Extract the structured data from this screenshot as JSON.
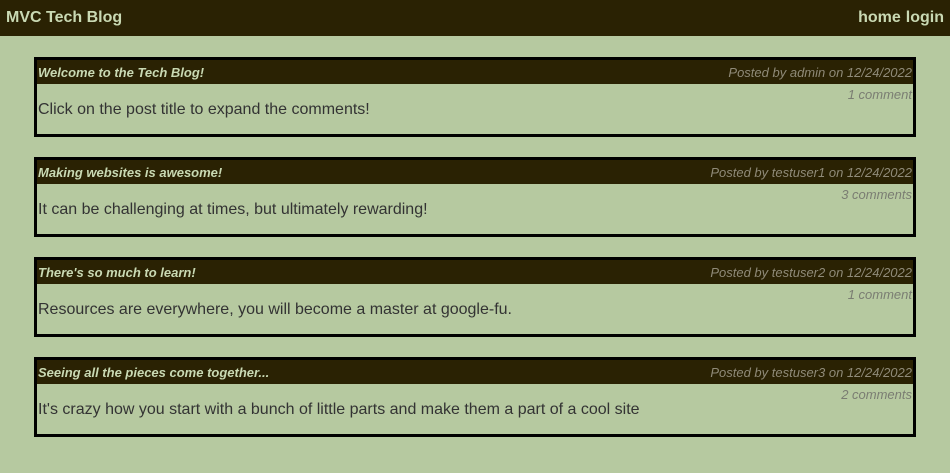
{
  "header": {
    "brand": "MVC Tech Blog",
    "nav": [
      {
        "label": "home"
      },
      {
        "label": "login"
      }
    ]
  },
  "posts": [
    {
      "title": "Welcome to the Tech Blog!",
      "meta": "Posted by admin on 12/24/2022",
      "comments": "1 comment",
      "content": "Click on the post title to expand the comments!"
    },
    {
      "title": "Making websites is awesome!",
      "meta": "Posted by testuser1 on 12/24/2022",
      "comments": "3 comments",
      "content": "It can be challenging at times, but ultimately rewarding!"
    },
    {
      "title": "There's so much to learn!",
      "meta": "Posted by testuser2 on 12/24/2022",
      "comments": "1 comment",
      "content": "Resources are everywhere, you will become a master at google-fu."
    },
    {
      "title": "Seeing all the pieces come together...",
      "meta": "Posted by testuser3 on 12/24/2022",
      "comments": "2 comments",
      "content": "It's crazy how you start with a bunch of little parts and make them a part of a cool site"
    }
  ],
  "colors": {
    "page_background": "#b6c9a0",
    "bar_background": "#2a2203",
    "header_text": "#c9d9b3",
    "post_border": "#000000"
  }
}
